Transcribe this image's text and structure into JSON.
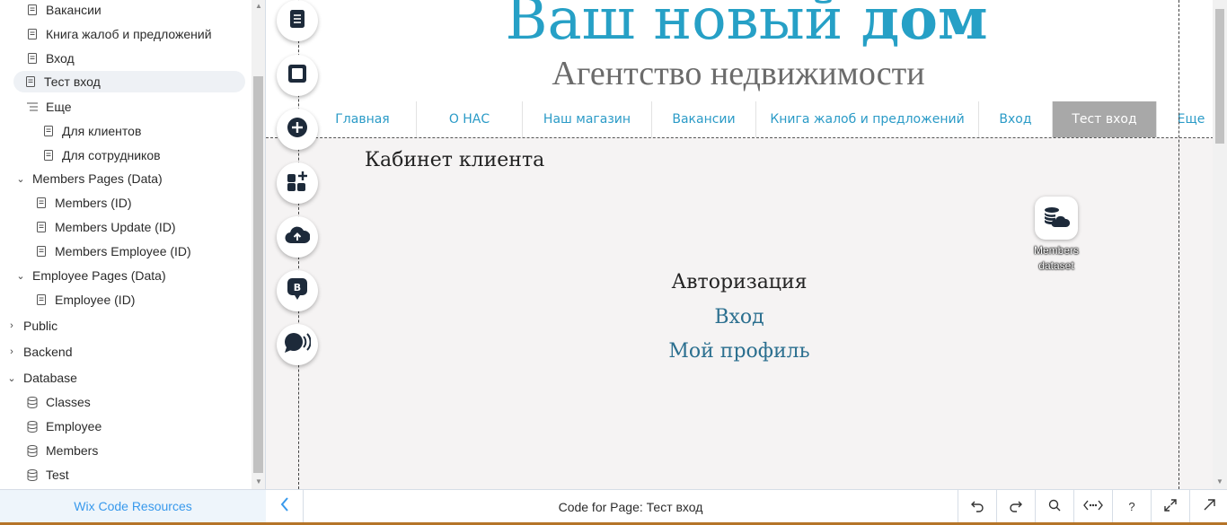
{
  "sidebar": {
    "items": [
      {
        "label": "Вакансии",
        "type": "page"
      },
      {
        "label": "Книга жалоб и предложений",
        "type": "page"
      },
      {
        "label": "Вход",
        "type": "page"
      },
      {
        "label": "Тест вход",
        "type": "page",
        "selected": true
      },
      {
        "label": "Еще",
        "type": "folder"
      },
      {
        "label": "Для клиентов",
        "type": "page"
      },
      {
        "label": "Для сотрудников",
        "type": "page"
      },
      {
        "label": "Members Pages (Data)",
        "type": "group",
        "expanded": true
      },
      {
        "label": "Members (ID)",
        "type": "page"
      },
      {
        "label": "Members Update (ID)",
        "type": "page"
      },
      {
        "label": "Members Employee (ID)",
        "type": "page"
      },
      {
        "label": "Employee Pages (Data)",
        "type": "group",
        "expanded": true
      },
      {
        "label": "Employee (ID)",
        "type": "page"
      },
      {
        "label": "Public",
        "type": "section",
        "expanded": false
      },
      {
        "label": "Backend",
        "type": "section",
        "expanded": false
      },
      {
        "label": "Database",
        "type": "section",
        "expanded": true
      },
      {
        "label": "Classes",
        "type": "db"
      },
      {
        "label": "Employee",
        "type": "db"
      },
      {
        "label": "Members",
        "type": "db"
      },
      {
        "label": "Test",
        "type": "db"
      }
    ],
    "resources_label": "Wix Code Resources"
  },
  "site": {
    "title_regular": "Ваш новый ",
    "title_bold": "дом",
    "subtitle": "Агентство недвижимости",
    "menu": [
      {
        "label": "Главная"
      },
      {
        "label": "О НАС"
      },
      {
        "label": "Наш магазин"
      },
      {
        "label": "Вакансии"
      },
      {
        "label": "Книга жалоб и предложений"
      },
      {
        "label": "Вход"
      },
      {
        "label": "Тест вход",
        "active": true
      },
      {
        "label": "Еще"
      }
    ],
    "cabinet": "Кабинет клиента",
    "auth": "Авторизация",
    "login_link": "Вход",
    "profile_link": "Мой профиль"
  },
  "dataset": {
    "label": "Members dataset",
    "icon": "database-cloud-icon"
  },
  "tools": [
    "pages-icon",
    "square-icon",
    "add-icon",
    "apps-icon",
    "upload-cloud-icon",
    "blog-icon",
    "chat-icon"
  ],
  "bottombar": {
    "code_label": "Code for Page: Тест вход",
    "buttons": [
      "undo-icon",
      "redo-icon",
      "search-icon",
      "code-properties-icon",
      "help-icon",
      "maximize-icon",
      "pop-out-icon"
    ],
    "help_label": "?"
  },
  "colors": {
    "accent": "#26a0c6",
    "link": "#2b6f8f",
    "active_menu": "#a8a8a8",
    "resources_text": "#3899ec"
  }
}
